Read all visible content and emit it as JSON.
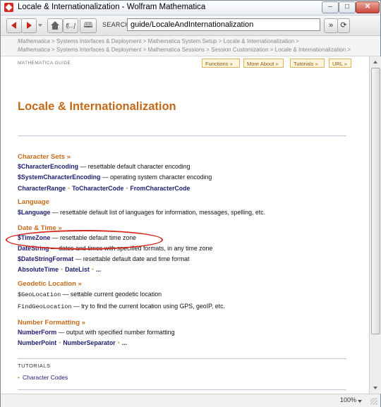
{
  "window": {
    "title": "Locale & Internationalization - Wolfram Mathematica"
  },
  "toolbar": {
    "search_label": "SEARCH",
    "search_value": "guide/LocaleAndInternationalization",
    "func_label": "f[...]",
    "go_label": "»",
    "book_label": "🕮",
    "refresh_label": "⟳"
  },
  "breadcrumbs": {
    "line1": [
      "Mathematica",
      "Systems Interfaces & Deployment",
      "Mathematica System Setup",
      "Locale & Internationalization"
    ],
    "line2": [
      "Mathematica",
      "Systems Interfaces & Deployment",
      "Mathematica Sessions",
      "Session Customization",
      "Locale & Internationalization"
    ]
  },
  "header": {
    "guide_label": "MATHEMATICA GUIDE",
    "buttons": [
      "Functions »",
      "More About »",
      "Tutorials »",
      "URL »"
    ]
  },
  "page_title": "Locale & Internationalization",
  "sections": {
    "charsets": {
      "heading": "Character Sets »",
      "r1_sym": "$CharacterEncoding",
      "r1_desc": " — resettable default character encoding",
      "r2_sym": "$SystemCharacterEncoding",
      "r2_desc": " — operating system character encoding",
      "r3": [
        "CharacterRange",
        "ToCharacterCode",
        "FromCharacterCode"
      ]
    },
    "language": {
      "heading": "Language",
      "r1_sym": "$Language",
      "r1_desc": " — resettable default list of languages for information, messages, spelling, etc."
    },
    "datetime": {
      "heading": "Date & Time »",
      "r1_sym": "$TimeZone",
      "r1_desc": " — resettable default time zone",
      "r2_sym": "DateString",
      "r2_desc": " — dates and times with specified formats, in any time zone",
      "r3_sym": "$DateStringFormat",
      "r3_desc": " — resettable default date and time format",
      "r4": [
        "AbsoluteTime",
        "DateList",
        "..."
      ]
    },
    "geo": {
      "heading": "Geodetic Location »",
      "r1_sym": "$GeoLocation",
      "r1_desc": " — settable current geodetic location",
      "r2_sym": "FindGeoLocation",
      "r2_desc": " — try to find the current location using GPS, geoIP, etc."
    },
    "numfmt": {
      "heading": "Number Formatting »",
      "r1_sym": "NumberForm",
      "r1_desc": " — output with specified number formatting",
      "r2": [
        "NumberPoint",
        "NumberSeparator",
        "..."
      ]
    }
  },
  "tutorials": {
    "label": "TUTORIALS",
    "items": [
      "Character Codes"
    ]
  },
  "statusbar": {
    "zoom": "100%"
  },
  "colors": {
    "accent": "#c36a1a",
    "symbol": "#1c1c70",
    "highlight": "#d8261a"
  }
}
